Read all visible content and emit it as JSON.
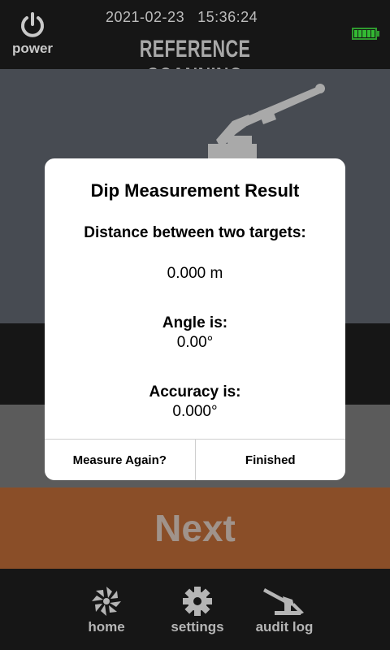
{
  "header": {
    "power_label": "power",
    "date": "2021-02-23",
    "time": "15:36:24",
    "title": "REFERENCE SCANNING",
    "battery_color": "#33bb33"
  },
  "main": {
    "next_label": "Next",
    "next_color": "#8a4e28"
  },
  "dialog": {
    "title": "Dip Measurement Result",
    "distance_label": "Distance between two targets:",
    "distance_value": "0.000 m",
    "angle_label": "Angle is:",
    "angle_value": "0.00°",
    "accuracy_label": "Accuracy is:",
    "accuracy_value": "0.000°",
    "measure_again_label": "Measure Again?",
    "finished_label": "Finished"
  },
  "nav": {
    "items": [
      {
        "label": "home",
        "icon": "home-icon"
      },
      {
        "label": "settings",
        "icon": "gear-icon"
      },
      {
        "label": "audit log",
        "icon": "audit-log-icon"
      }
    ]
  },
  "icons": {
    "power": "power-icon",
    "battery": "battery-icon",
    "scanner": "scanner-icon"
  }
}
